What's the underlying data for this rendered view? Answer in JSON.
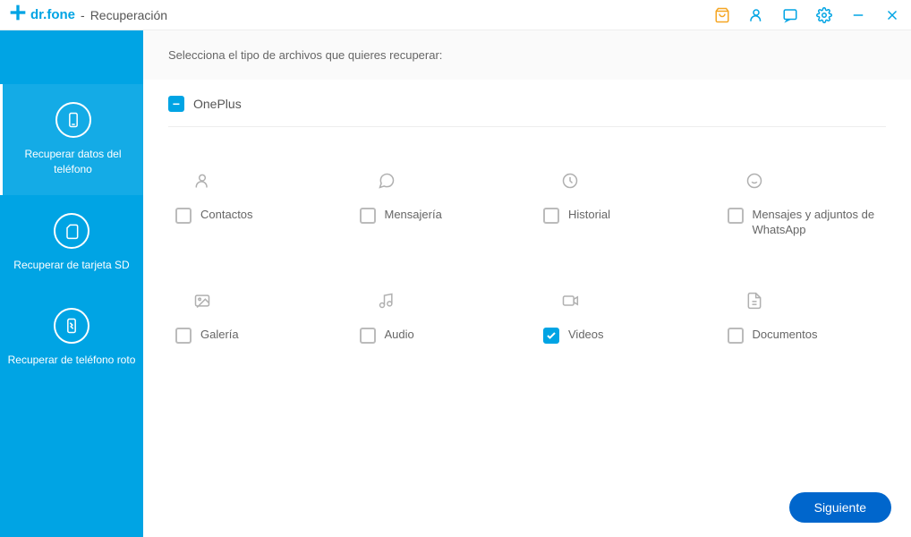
{
  "brand": "dr.fone",
  "module_name": "Recuperación",
  "sidebar": {
    "items": [
      {
        "label": "Recuperar datos del teléfono"
      },
      {
        "label": "Recuperar de tarjeta SD"
      },
      {
        "label": "Recuperar de teléfono roto"
      }
    ]
  },
  "main": {
    "instruction": "Selecciona el tipo de archivos que quieres recuperar:",
    "device": "OnePlus",
    "types": [
      {
        "label": "Contactos",
        "checked": false
      },
      {
        "label": "Mensajería",
        "checked": false
      },
      {
        "label": "Historial",
        "checked": false
      },
      {
        "label": "Mensajes y adjuntos de WhatsApp",
        "checked": false
      },
      {
        "label": "Galería",
        "checked": false
      },
      {
        "label": "Audio",
        "checked": false
      },
      {
        "label": "Videos",
        "checked": true
      },
      {
        "label": "Documentos",
        "checked": false
      }
    ],
    "next_button": "Siguiente"
  }
}
